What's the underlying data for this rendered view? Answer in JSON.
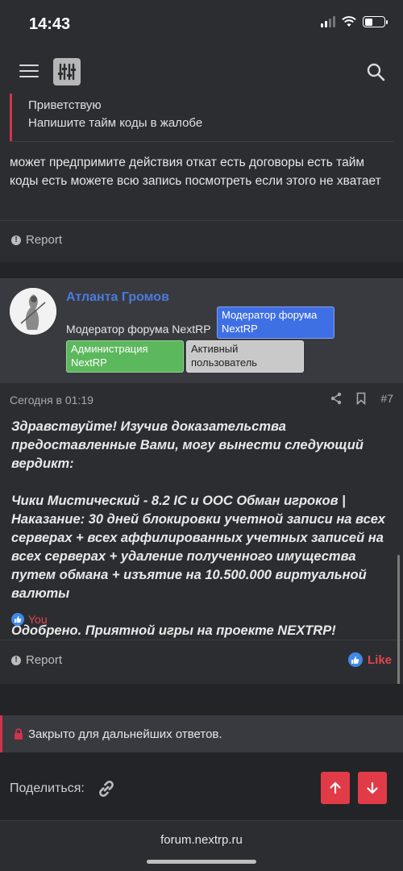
{
  "status": {
    "time": "14:43"
  },
  "nav": {
    "logo_icon": "xenforo-logo",
    "menu_icon": "hamburger-icon",
    "search_icon": "search-icon"
  },
  "prev_post": {
    "quote_lines": [
      "Приветствую",
      "Напишите тайм коды в жалобе"
    ],
    "text": "может предпримите действия откат есть договоры есть тайм коды есть можете всю запись посмотреть если этого не хватает",
    "report_label": "Report"
  },
  "post": {
    "author": "Атланта Громов",
    "author_title": "Модератор форума NextRP",
    "badges": {
      "mod": "Модератор форума NextRP",
      "admin": "Администрация NextRP",
      "active": "Активный пользователь"
    },
    "date": "Сегодня в 01:19",
    "number": "#7",
    "body": [
      "Здравствуйте! Изучив доказательства предоставленные Вами, могу вынести следующий вердикт:",
      "Чики Мистический - 8.2 IC и OOC Обман игроков | Наказание: 30 дней блокировки учетной записи на всех серверах + всех аффилированных учетных записей на всех серверах + удаление полученного имущества путем обмана + изъятие на 10.500.000 виртуальной валюты",
      "Одобрено. Приятной игры на проекте NEXTRP!"
    ],
    "reaction_by": "You",
    "report_label": "Report",
    "like_label": "Like"
  },
  "thread": {
    "closed_text": "Закрыто для дальнейших ответов.",
    "share_label": "Поделиться:"
  },
  "footer": {
    "url": "forum.nextrp.ru"
  },
  "colors": {
    "accent": "#e13b48",
    "link": "#4a7bdc",
    "bg": "#2c2d31"
  }
}
